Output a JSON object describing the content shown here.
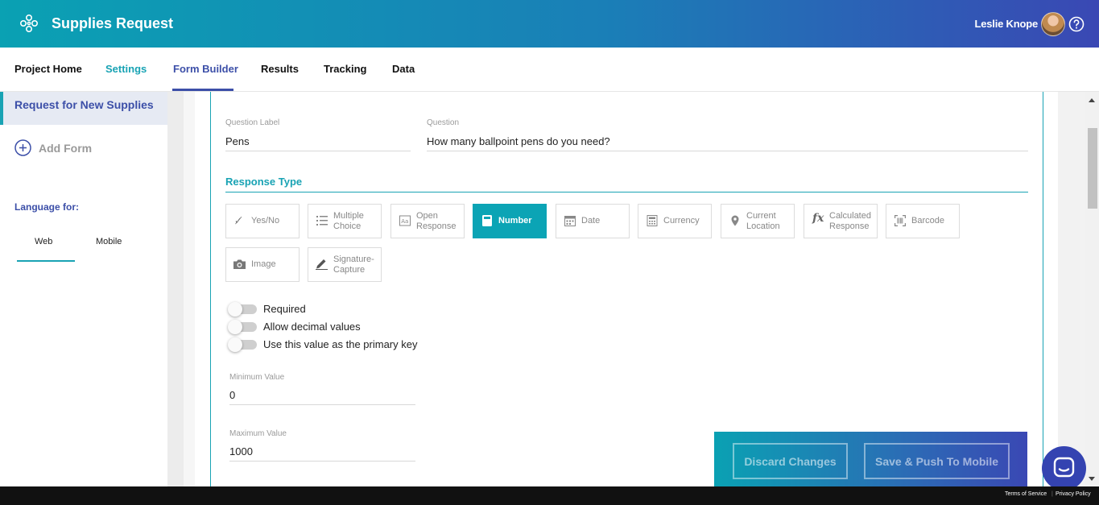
{
  "header": {
    "app_title": "Supplies Request",
    "user_name": "Leslie Knope",
    "logo_icon": "flower-logo-icon",
    "help_icon": "question-circle-icon"
  },
  "nav": {
    "tabs": [
      {
        "label": "Project Home"
      },
      {
        "label": "Settings"
      },
      {
        "label": "Form Builder"
      },
      {
        "label": "Results"
      },
      {
        "label": "Tracking"
      },
      {
        "label": "Data"
      }
    ],
    "active": "Form Builder"
  },
  "sidebar": {
    "form_name": "Request for New Supplies",
    "add_form_label": "Add Form",
    "language_label": "Language for:",
    "language_tabs": [
      "Web",
      "Mobile"
    ],
    "active_language": "Web"
  },
  "question": {
    "label_caption": "Question Label",
    "label_value": "Pens",
    "question_caption": "Question",
    "question_value": "How many ballpoint pens do you need?"
  },
  "response_type": {
    "title": "Response Type",
    "options": [
      {
        "label": "Yes/No",
        "icon": "yes-no-icon"
      },
      {
        "label": "Multiple Choice",
        "icon": "list-icon"
      },
      {
        "label": "Open Response",
        "icon": "text-box-icon"
      },
      {
        "label": "Number",
        "icon": "number-icon"
      },
      {
        "label": "Date",
        "icon": "calendar-icon"
      },
      {
        "label": "Currency",
        "icon": "currency-icon"
      },
      {
        "label": "Current Location",
        "icon": "map-pin-icon"
      },
      {
        "label": "Calculated Response",
        "icon": "function-icon"
      },
      {
        "label": "Barcode",
        "icon": "barcode-icon"
      },
      {
        "label": "Image",
        "icon": "camera-icon"
      },
      {
        "label": "Signature-Capture",
        "icon": "pen-icon"
      }
    ],
    "selected": "Number"
  },
  "toggles": [
    {
      "label": "Required",
      "on": false
    },
    {
      "label": "Allow decimal values",
      "on": false
    },
    {
      "label": "Use this value as the primary key",
      "on": false
    }
  ],
  "limits": {
    "min_caption": "Minimum Value",
    "min_value": "0",
    "max_caption": "Maximum Value",
    "max_value": "1000"
  },
  "actions": {
    "discard": "Discard Changes",
    "save": "Save & Push To Mobile"
  },
  "footer": {
    "terms": "Terms of Service",
    "privacy": "Privacy Policy"
  },
  "colors": {
    "accent_teal": "#0ba4b5",
    "accent_blue": "#3c4fa8"
  }
}
